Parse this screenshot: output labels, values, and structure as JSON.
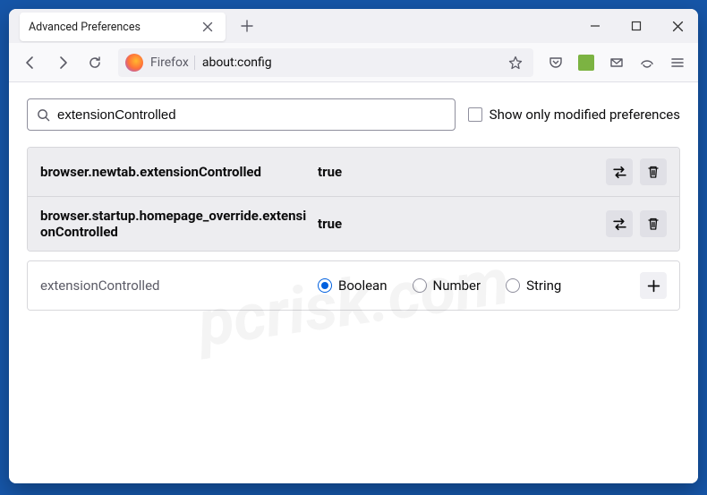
{
  "tab": {
    "title": "Advanced Preferences"
  },
  "urlbar": {
    "identity": "Firefox",
    "url": "about:config"
  },
  "search": {
    "placeholder": "",
    "value": "extensionControlled"
  },
  "showOnlyModified": {
    "label": "Show only modified preferences"
  },
  "prefs": [
    {
      "name": "browser.newtab.extensionControlled",
      "value": "true"
    },
    {
      "name": "browser.startup.homepage_override.extensionControlled",
      "value": "true"
    }
  ],
  "newPref": {
    "name": "extensionControlled",
    "types": [
      "Boolean",
      "Number",
      "String"
    ],
    "selected": "Boolean"
  },
  "watermark": "pcrisk.com"
}
